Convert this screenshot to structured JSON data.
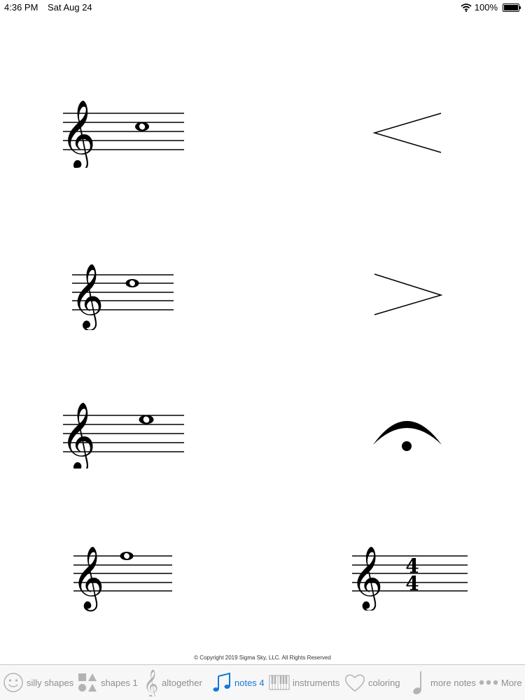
{
  "status_bar": {
    "time": "4:36 PM",
    "date": "Sat Aug 24",
    "battery_text": "100%",
    "battery_level": 1.0
  },
  "symbols": [
    {
      "name": "treble-staff-note-1",
      "icon": "treble-clef-whole-note"
    },
    {
      "name": "crescendo",
      "icon": "crescendo-hairpin"
    },
    {
      "name": "treble-staff-note-2",
      "icon": "treble-clef-whole-note"
    },
    {
      "name": "decrescendo",
      "icon": "decrescendo-hairpin"
    },
    {
      "name": "treble-staff-note-3",
      "icon": "treble-clef-whole-note"
    },
    {
      "name": "fermata",
      "icon": "fermata"
    },
    {
      "name": "treble-staff-note-4",
      "icon": "treble-clef-whole-note"
    },
    {
      "name": "common-time-signature",
      "icon": "treble-clef-time-signature"
    }
  ],
  "time_signature": {
    "top": "4",
    "bottom": "4"
  },
  "copyright": "© Copyright  2019 Sigma Sky, LLC. All Rights Reserved",
  "tabs": [
    {
      "label": "silly shapes",
      "icon": "smiley-face-icon"
    },
    {
      "label": "shapes 1",
      "icon": "shapes-icon"
    },
    {
      "label": "altogether",
      "icon": "treble-clef-icon"
    },
    {
      "label": "notes 4",
      "icon": "music-notes-icon",
      "active": true
    },
    {
      "label": "instruments",
      "icon": "piano-keys-icon"
    },
    {
      "label": "coloring",
      "icon": "heart-icon"
    },
    {
      "label": "more notes",
      "icon": "quarter-note-icon"
    },
    {
      "label": "More",
      "icon": "ellipsis-icon"
    }
  ],
  "colors": {
    "active_tab": "#1479d9",
    "inactive_tab": "#8e8e8e",
    "tabbar_bg": "#f7f7f7"
  }
}
